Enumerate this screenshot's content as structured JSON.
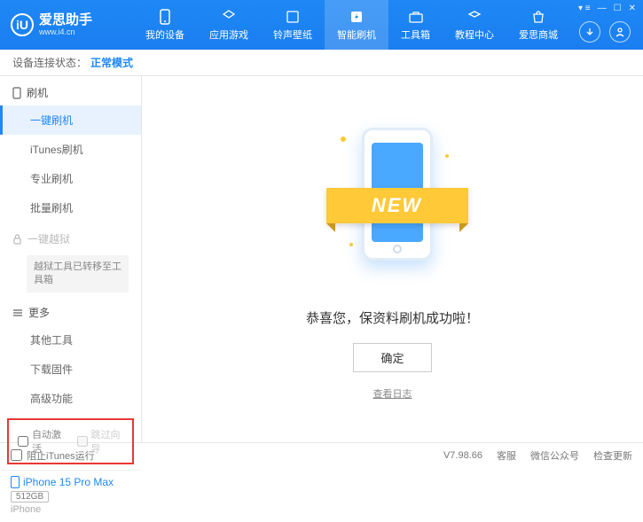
{
  "app": {
    "name": "爱思助手",
    "url": "www.i4.cn",
    "logo_letter": "iU"
  },
  "nav": [
    {
      "label": "我的设备"
    },
    {
      "label": "应用游戏"
    },
    {
      "label": "铃声壁纸"
    },
    {
      "label": "智能刷机",
      "active": true
    },
    {
      "label": "工具箱"
    },
    {
      "label": "教程中心"
    },
    {
      "label": "爱思商城"
    }
  ],
  "status": {
    "label": "设备连接状态：",
    "value": "正常模式"
  },
  "sidebar": {
    "group1": {
      "title": "刷机"
    },
    "items1": [
      {
        "label": "一键刷机",
        "active": true
      },
      {
        "label": "iTunes刷机"
      },
      {
        "label": "专业刷机"
      },
      {
        "label": "批量刷机"
      }
    ],
    "group2": {
      "title": "一键越狱"
    },
    "note": "越狱工具已转移至工具箱",
    "group3": {
      "title": "更多"
    },
    "items3": [
      {
        "label": "其他工具"
      },
      {
        "label": "下载固件"
      },
      {
        "label": "高级功能"
      }
    ],
    "checks": {
      "auto": "自动激活",
      "skip": "跳过向导"
    },
    "device": {
      "name": "iPhone 15 Pro Max",
      "capacity": "512GB",
      "type": "iPhone"
    }
  },
  "main": {
    "ribbon": "NEW",
    "message": "恭喜您，保资料刷机成功啦！",
    "ok": "确定",
    "log": "查看日志"
  },
  "footer": {
    "itunes": "阻止iTunes运行",
    "version": "V7.98.66",
    "links": [
      "客服",
      "微信公众号",
      "检查更新"
    ]
  }
}
